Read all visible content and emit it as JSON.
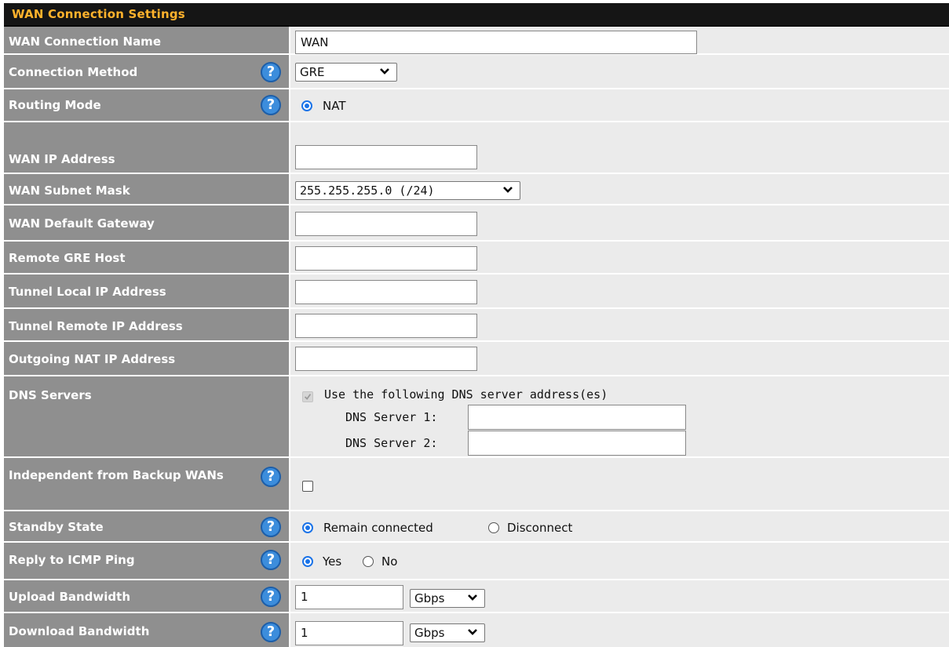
{
  "header": {
    "title": "WAN Connection Settings"
  },
  "rows": {
    "wan_name": {
      "label": "WAN Connection Name",
      "value": "WAN"
    },
    "conn_method": {
      "label": "Connection Method",
      "value": "GRE"
    },
    "routing_mode": {
      "label": "Routing Mode",
      "option": "NAT"
    },
    "wan_ip": {
      "label": "WAN IP Address",
      "value": ""
    },
    "subnet": {
      "label": "WAN Subnet Mask",
      "value": "255.255.255.0 (/24)"
    },
    "gateway": {
      "label": "WAN Default Gateway",
      "value": ""
    },
    "remote_gre": {
      "label": "Remote GRE Host",
      "value": ""
    },
    "tunnel_local": {
      "label": "Tunnel Local IP Address",
      "value": ""
    },
    "tunnel_remote": {
      "label": "Tunnel Remote IP Address",
      "value": ""
    },
    "outgoing_nat": {
      "label": "Outgoing NAT IP Address",
      "value": ""
    },
    "dns": {
      "label": "DNS Servers",
      "checkbox_label": "Use the following DNS server address(es)",
      "server1_label": "DNS Server 1:",
      "server2_label": "DNS Server 2:",
      "server1_value": "",
      "server2_value": ""
    },
    "independent": {
      "label": "Independent from Backup WANs"
    },
    "standby": {
      "label": "Standby State",
      "option1": "Remain connected",
      "option2": "Disconnect"
    },
    "icmp": {
      "label": "Reply to ICMP Ping",
      "option1": "Yes",
      "option2": "No"
    },
    "upload": {
      "label": "Upload Bandwidth",
      "value": "1",
      "unit": "Gbps"
    },
    "download": {
      "label": "Download Bandwidth",
      "value": "1",
      "unit": "Gbps"
    }
  },
  "help_glyph": "?",
  "colors": {
    "header_bg": "#151515",
    "header_text": "#ffb22c",
    "label_bg": "#8f8f8f",
    "value_bg": "#ebebeb",
    "help_blue": "#3c8ddc",
    "radio_blue": "#1a73e8"
  }
}
